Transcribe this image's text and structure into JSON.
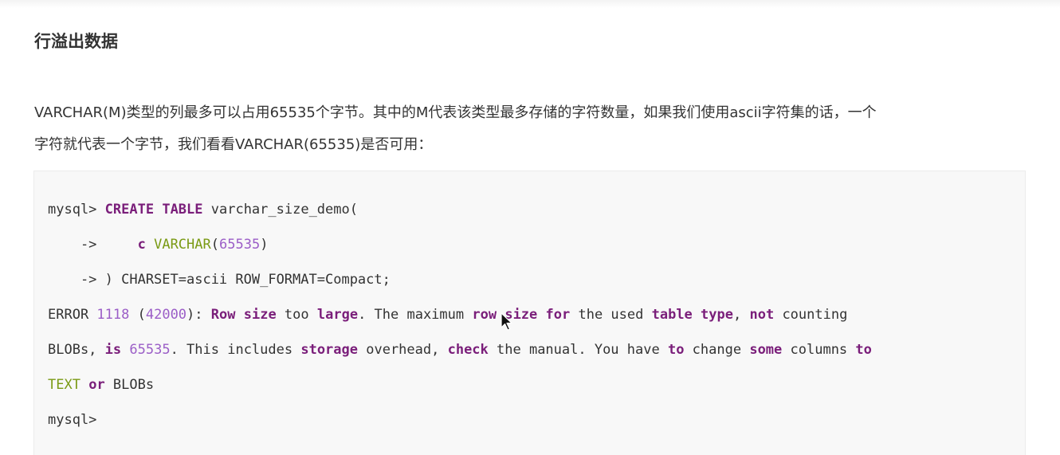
{
  "heading": "行溢出数据",
  "paragraph": {
    "line1": "VARCHAR(M)类型的列最多可以占用65535个字节。其中的M代表该类型最多存储的字符数量，如果我们使用ascii字符集的话，一个",
    "line2": "字符就代表一个字节，我们看看VARCHAR(65535)是否可用："
  },
  "code": {
    "lines": [
      [
        {
          "t": "mysql> ",
          "s": "plain"
        },
        {
          "t": "CREATE",
          "s": "kw"
        },
        {
          "t": " ",
          "s": "plain"
        },
        {
          "t": "TABLE",
          "s": "kw"
        },
        {
          "t": " varchar_size_demo(",
          "s": "plain"
        }
      ],
      [
        {
          "t": "    ->     ",
          "s": "plain"
        },
        {
          "t": "c",
          "s": "kw"
        },
        {
          "t": " ",
          "s": "plain"
        },
        {
          "t": "VARCHAR",
          "s": "ty"
        },
        {
          "t": "(",
          "s": "plain"
        },
        {
          "t": "65535",
          "s": "num"
        },
        {
          "t": ")",
          "s": "plain"
        }
      ],
      [
        {
          "t": "    -> ) CHARSET=ascii ROW_FORMAT=Compact;",
          "s": "plain"
        }
      ],
      [
        {
          "t": "ERROR ",
          "s": "plain"
        },
        {
          "t": "1118",
          "s": "num"
        },
        {
          "t": " (",
          "s": "plain"
        },
        {
          "t": "42000",
          "s": "num"
        },
        {
          "t": "): ",
          "s": "plain"
        },
        {
          "t": "Row",
          "s": "kw"
        },
        {
          "t": " ",
          "s": "plain"
        },
        {
          "t": "size",
          "s": "kw"
        },
        {
          "t": " too ",
          "s": "plain"
        },
        {
          "t": "large",
          "s": "kw"
        },
        {
          "t": ". The maximum ",
          "s": "plain"
        },
        {
          "t": "row",
          "s": "kw"
        },
        {
          "t": " ",
          "s": "plain"
        },
        {
          "t": "size",
          "s": "kw"
        },
        {
          "t": " ",
          "s": "plain"
        },
        {
          "t": "for",
          "s": "kw"
        },
        {
          "t": " the used ",
          "s": "plain"
        },
        {
          "t": "table",
          "s": "kw"
        },
        {
          "t": " ",
          "s": "plain"
        },
        {
          "t": "type",
          "s": "kw"
        },
        {
          "t": ", ",
          "s": "plain"
        },
        {
          "t": "not",
          "s": "kw"
        },
        {
          "t": " counting",
          "s": "plain"
        }
      ],
      [
        {
          "t": "BLOBs, ",
          "s": "plain"
        },
        {
          "t": "is",
          "s": "kw"
        },
        {
          "t": " ",
          "s": "plain"
        },
        {
          "t": "65535",
          "s": "num"
        },
        {
          "t": ". This includes ",
          "s": "plain"
        },
        {
          "t": "storage",
          "s": "kw"
        },
        {
          "t": " overhead, ",
          "s": "plain"
        },
        {
          "t": "check",
          "s": "kw"
        },
        {
          "t": " the manual. You have ",
          "s": "plain"
        },
        {
          "t": "to",
          "s": "kw"
        },
        {
          "t": " change ",
          "s": "plain"
        },
        {
          "t": "some",
          "s": "kw"
        },
        {
          "t": " columns ",
          "s": "plain"
        },
        {
          "t": "to",
          "s": "kw"
        }
      ],
      [
        {
          "t": "TEXT",
          "s": "ty"
        },
        {
          "t": " ",
          "s": "plain"
        },
        {
          "t": "or",
          "s": "kw"
        },
        {
          "t": " BLOBs",
          "s": "plain"
        }
      ],
      [
        {
          "t": "mysql>",
          "s": "plain"
        }
      ]
    ]
  },
  "colors": {
    "keyword": "#7a1e7a",
    "number": "#9b5ec7",
    "type": "#7a9a14",
    "text": "#333333",
    "code_bg": "#f8f8f8"
  },
  "icons": {
    "cursor": "mouse-pointer-icon"
  }
}
